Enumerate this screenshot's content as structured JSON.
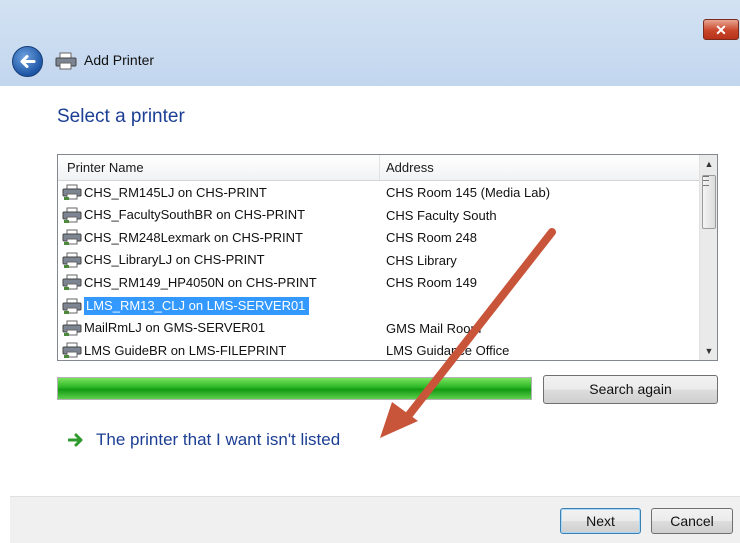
{
  "window": {
    "title": "Add Printer",
    "close_label": "✕"
  },
  "main": {
    "heading": "Select a printer",
    "columns": [
      "Printer Name",
      "Address"
    ],
    "printers": [
      {
        "name": "CHS_RM145LJ on CHS-PRINT",
        "address": "CHS Room 145 (Media Lab)"
      },
      {
        "name": "CHS_FacultySouthBR on CHS-PRINT",
        "address": "CHS Faculty South"
      },
      {
        "name": "CHS_RM248Lexmark on CHS-PRINT",
        "address": "CHS Room 248"
      },
      {
        "name": "CHS_LibraryLJ on CHS-PRINT",
        "address": "CHS Library"
      },
      {
        "name": "CHS_RM149_HP4050N on CHS-PRINT",
        "address": "CHS Room 149"
      },
      {
        "name": "LMS_RM13_CLJ on LMS-SERVER01",
        "address": "",
        "selected": true
      },
      {
        "name": "MailRmLJ on GMS-SERVER01",
        "address": "GMS Mail Room"
      },
      {
        "name": "LMS GuideBR on LMS-FILEPRINT",
        "address": "LMS Guidance Office"
      }
    ],
    "search_progress": 1.0,
    "search_again_label": "Search again",
    "not_listed_link": "The printer that I want isn't listed"
  },
  "footer": {
    "next_label": "Next",
    "cancel_label": "Cancel"
  },
  "colors": {
    "accent": "#1c3f94",
    "selection": "#3399ff",
    "progress": "#2bb523",
    "annotation_arrow": "#c8553a"
  }
}
